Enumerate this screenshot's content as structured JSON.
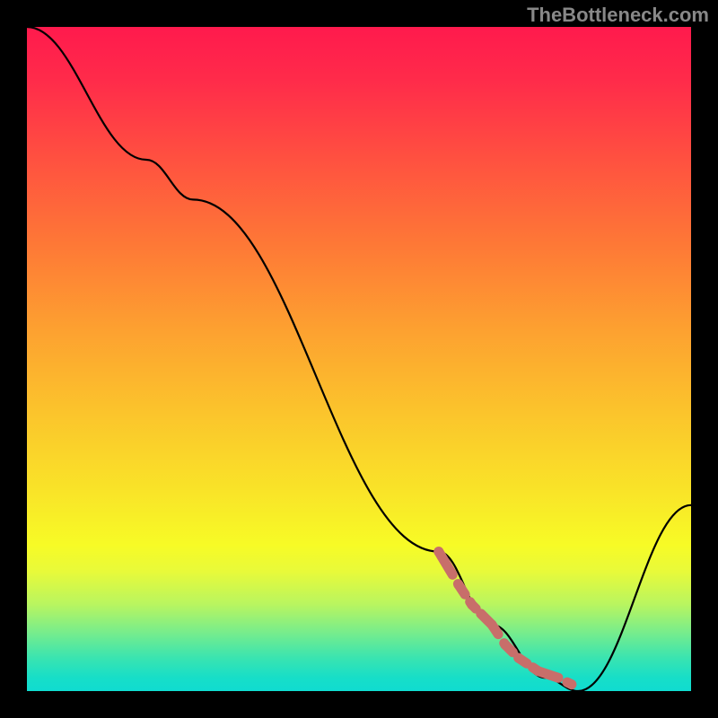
{
  "watermark": "TheBottleneck.com",
  "chart_data": {
    "type": "line",
    "title": "",
    "xlabel": "",
    "ylabel": "",
    "xlim": [
      0,
      100
    ],
    "ylim": [
      0,
      100
    ],
    "series": [
      {
        "name": "curve",
        "x": [
          0,
          18,
          25,
          62,
          70,
          78,
          83,
          100
        ],
        "values": [
          100,
          80,
          74,
          21,
          10,
          2,
          0,
          28
        ]
      },
      {
        "name": "marker-segment",
        "x": [
          62,
          65,
          67,
          70,
          72,
          74,
          77,
          80,
          82
        ],
        "values": [
          21,
          16,
          13,
          10,
          7,
          5,
          3,
          2,
          1
        ]
      }
    ],
    "colors": {
      "curve": "#000000",
      "marker": "#c86e6a"
    }
  }
}
